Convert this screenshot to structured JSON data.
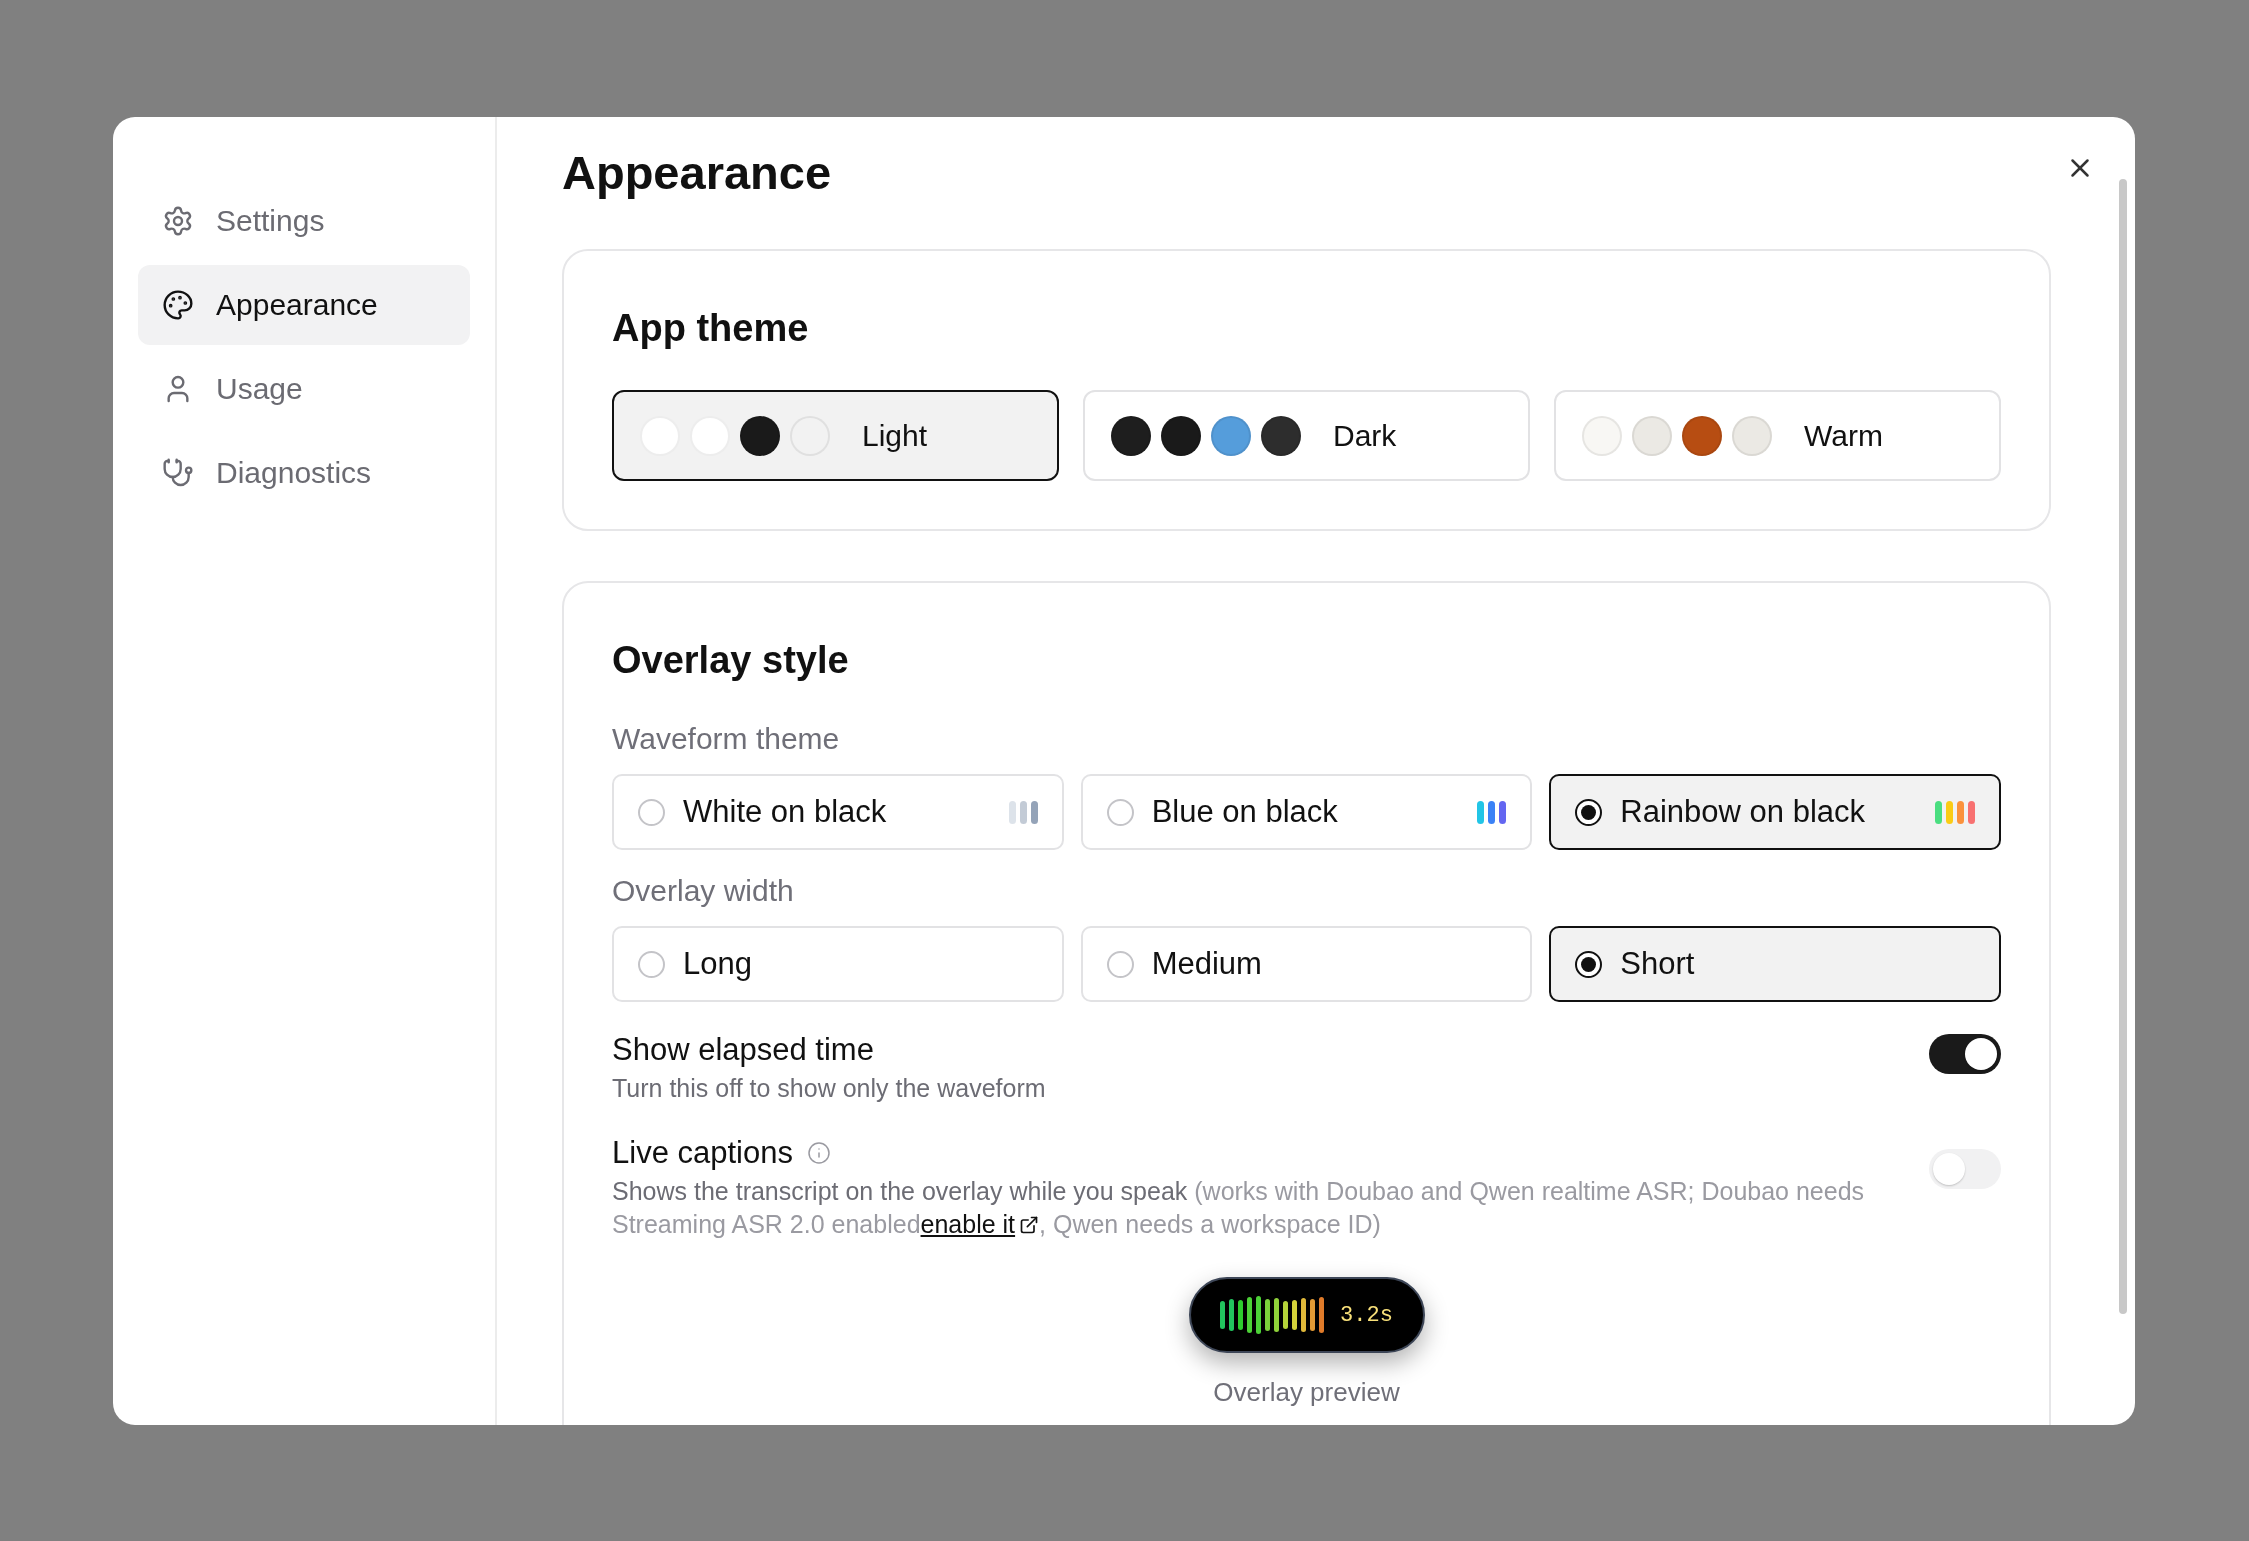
{
  "sidebar": {
    "items": [
      {
        "label": "Settings",
        "selected": false
      },
      {
        "label": "Appearance",
        "selected": true
      },
      {
        "label": "Usage",
        "selected": false
      },
      {
        "label": "Diagnostics",
        "selected": false
      }
    ]
  },
  "title": "Appearance",
  "app_theme": {
    "title": "App theme",
    "options": [
      {
        "label": "Light",
        "selected": true,
        "swatches": [
          {
            "color": "#ffffff"
          },
          {
            "color": "#ffffff"
          },
          {
            "color": "#1a1a1a"
          },
          {
            "color": "#f2f2f2"
          }
        ]
      },
      {
        "label": "Dark",
        "selected": false,
        "swatches": [
          {
            "color": "#1e1e1e"
          },
          {
            "color": "#1a1a1a"
          },
          {
            "color": "#559ddb"
          },
          {
            "color": "#2d2d2d"
          }
        ]
      },
      {
        "label": "Warm",
        "selected": false,
        "swatches": [
          {
            "color": "#f8f7f4"
          },
          {
            "color": "#ebe9e4"
          },
          {
            "color": "#b74d12"
          },
          {
            "color": "#ebe9e4"
          }
        ]
      }
    ]
  },
  "overlay_style": {
    "title": "Overlay style",
    "waveform_theme": {
      "label": "Waveform theme",
      "options": [
        {
          "label": "White on black",
          "selected": false,
          "bars": [
            {
              "color": "#dde3ea"
            },
            {
              "color": "#c3cbd6"
            },
            {
              "color": "#94a3b8"
            }
          ]
        },
        {
          "label": "Blue on black",
          "selected": false,
          "bars": [
            {
              "color": "#22c5e6"
            },
            {
              "color": "#3b82f6"
            },
            {
              "color": "#6366f1"
            }
          ]
        },
        {
          "label": "Rainbow on black",
          "selected": true,
          "bars": [
            {
              "color": "#4ade80"
            },
            {
              "color": "#facc15"
            },
            {
              "color": "#fb923c"
            },
            {
              "color": "#f87171"
            }
          ]
        }
      ]
    },
    "overlay_width": {
      "label": "Overlay width",
      "options": [
        {
          "label": "Long",
          "selected": false
        },
        {
          "label": "Medium",
          "selected": false
        },
        {
          "label": "Short",
          "selected": true
        }
      ]
    },
    "toggles": [
      {
        "title": "Show elapsed time",
        "description": "Turn this off to show only the waveform",
        "on": true
      },
      {
        "title": "Live captions",
        "description": "Shows the transcript on the overlay while you speak",
        "note": "(works with Doubao and Qwen realtime ASR; Doubao needs Streaming ASR 2.0 enabled",
        "link": "enable it",
        "note_tail": ", Qwen needs a workspace ID)",
        "on": false
      }
    ],
    "preview": {
      "time": "3.2s",
      "caption": "Overlay preview"
    }
  }
}
